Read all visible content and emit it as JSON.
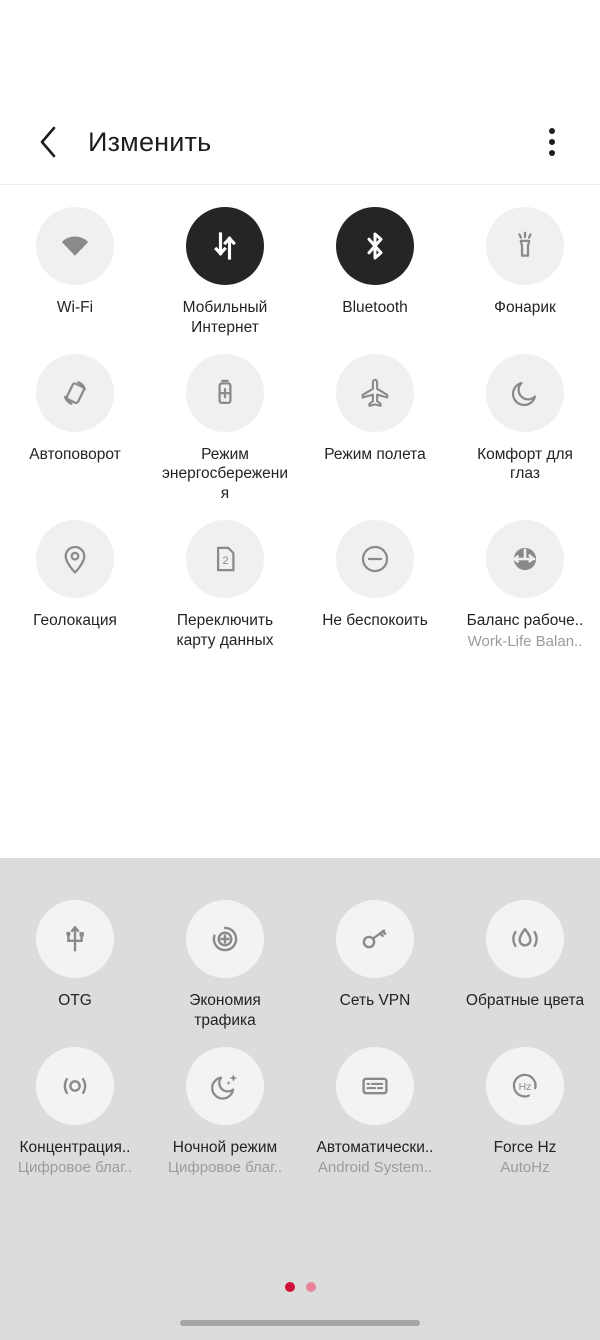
{
  "header": {
    "title": "Изменить",
    "back_icon": "chevron-left-icon",
    "menu_icon": "overflow-menu-icon"
  },
  "colors": {
    "tile_off_bg": "#f0f0f0",
    "tile_on_bg": "#252525",
    "icon_gray": "#8a8a8a",
    "panel_bottom_bg": "#dcdcdc",
    "dot_active": "#d0103a",
    "dot_inactive": "#e8839c",
    "home_indicator": "#a6a6a6"
  },
  "active_tiles": {
    "tiles": [
      {
        "label": "Wi-Fi",
        "sub": "",
        "icon": "wifi-icon",
        "state": "off"
      },
      {
        "label": "Мобильный Интернет",
        "sub": "",
        "icon": "mobile-data-icon",
        "state": "on"
      },
      {
        "label": "Bluetooth",
        "sub": "",
        "icon": "bluetooth-icon",
        "state": "on"
      },
      {
        "label": "Фонарик",
        "sub": "",
        "icon": "flashlight-icon",
        "state": "off"
      },
      {
        "label": "Автоповорот",
        "sub": "",
        "icon": "auto-rotate-icon",
        "state": "off"
      },
      {
        "label": "Режим энергосбережения",
        "sub": "",
        "icon": "battery-saver-icon",
        "state": "off"
      },
      {
        "label": "Режим полета",
        "sub": "",
        "icon": "airplane-icon",
        "state": "off"
      },
      {
        "label": "Комфорт для глаз",
        "sub": "",
        "icon": "eye-comfort-icon",
        "state": "off"
      },
      {
        "label": "Геолокация",
        "sub": "",
        "icon": "location-pin-icon",
        "state": "off"
      },
      {
        "label": "Переключить карту данных",
        "sub": "",
        "icon": "sim-card-2-icon",
        "state": "off"
      },
      {
        "label": "Не беспокоить",
        "sub": "",
        "icon": "do-not-disturb-icon",
        "state": "off"
      },
      {
        "label": "Баланс рабоче..",
        "sub": "Work-Life Balan..",
        "icon": "work-life-balance-icon",
        "state": "off"
      }
    ]
  },
  "available_tiles": {
    "tiles": [
      {
        "label": "OTG",
        "sub": "",
        "icon": "usb-otg-icon",
        "state": "off"
      },
      {
        "label": "Экономия трафика",
        "sub": "",
        "icon": "data-saver-icon",
        "state": "off"
      },
      {
        "label": "Сеть VPN",
        "sub": "",
        "icon": "vpn-key-icon",
        "state": "off"
      },
      {
        "label": "Обратные цвета",
        "sub": "",
        "icon": "invert-colors-icon",
        "state": "off"
      },
      {
        "label": "Концентрация..",
        "sub": "Цифровое благ..",
        "icon": "focus-mode-icon",
        "state": "off"
      },
      {
        "label": "Ночной режим",
        "sub": "Цифровое благ..",
        "icon": "bedtime-icon",
        "state": "off"
      },
      {
        "label": "Автоматически..",
        "sub": "Android System..",
        "icon": "live-caption-icon",
        "state": "off"
      },
      {
        "label": "Force Hz",
        "sub": "AutoHz",
        "icon": "refresh-rate-hz-icon",
        "state": "off"
      }
    ]
  },
  "pagination_top": {
    "pages": 2,
    "current": 1
  },
  "pagination_bottom": {
    "pages": 2,
    "current": 1
  }
}
